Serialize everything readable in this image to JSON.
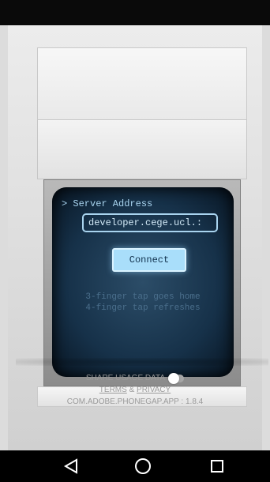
{
  "screen": {
    "server_label": "> Server Address",
    "server_value": "developer.cege.ucl.:",
    "connect_label": "Connect",
    "hint_three_finger": "3-finger tap goes home",
    "hint_four_finger": "4-finger tap refreshes"
  },
  "footer": {
    "share_usage_label": "SHARE USAGE DATA",
    "share_usage_enabled": false,
    "terms_label": "TERMS",
    "ampersand": "&",
    "privacy_label": "PRIVACY",
    "version_label": "COM.ADOBE.PHONEGAP.APP : 1.8.4"
  },
  "nav": {
    "back_icon": "back-triangle-icon",
    "home_icon": "home-circle-icon",
    "recent_icon": "recent-square-icon"
  },
  "colors": {
    "screen_text": "#a9d4ef",
    "button": "#a9defa",
    "hint_text": "#4b6f8c"
  }
}
